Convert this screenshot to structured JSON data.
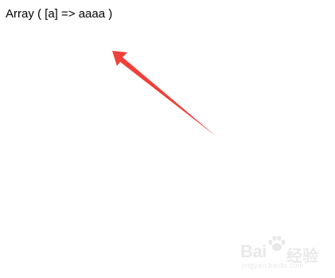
{
  "output": {
    "text": "Array ( [a] => aaaa )"
  },
  "annotation": {
    "arrow_color": "#f0403a"
  },
  "watermark": {
    "brand": "Bai",
    "brand_cn": "经验",
    "url": "jingyan.baidu.com",
    "icon": "paw-icon"
  }
}
